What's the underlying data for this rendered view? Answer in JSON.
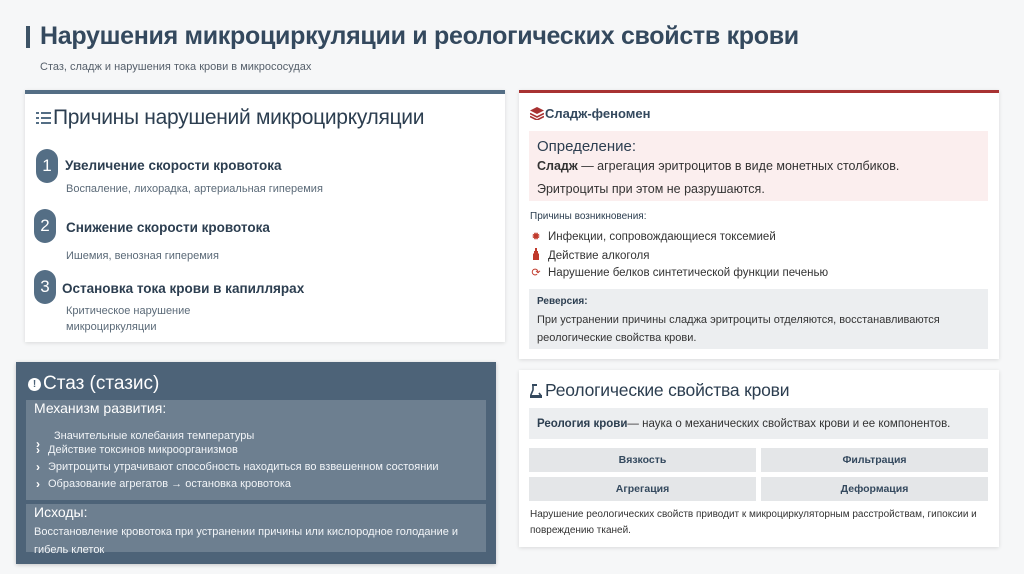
{
  "header": {
    "title": "Нарушения микроциркуляции и реологических свойств крови",
    "subtitle": "Стаз, сладж и нарушения тока крови в микрососудах"
  },
  "causes": {
    "title": "Причины нарушений микроциркуляции",
    "icon": "list-icon",
    "items": [
      {
        "num": "1",
        "title": "Увеличение скорости кровотока",
        "desc": "Воспаление, лихорадка, артериальная гиперемия"
      },
      {
        "num": "2",
        "title": "Снижение скорости кровотока",
        "desc": "Ишемия, венозная гиперемия"
      },
      {
        "num": "3",
        "title": "Остановка тока крови в капиллярах",
        "desc_line1": "Критическое нарушение",
        "desc_line2": "микроциркуляции"
      }
    ]
  },
  "stasis": {
    "title": "Стаз (стазис)",
    "icon": "exclamation-circle-icon",
    "mechanism_head": "Механизм развития:",
    "mechanism": [
      "Значительные колебания температуры",
      "Действие токсинов микроорганизмов",
      "Эритроциты утрачивают способность находиться во взвешенном состоянии",
      "Образование агрегатов → остановка кровотока"
    ],
    "outcome_head": "Исходы:",
    "outcome_text": "Восстановление кровотока при устранении причины или кислородное голодание и гибель клеток"
  },
  "sludge": {
    "title": "Сладж-феномен",
    "icon": "layers-icon",
    "definition_head": "Определение:",
    "definition_term": "Сладж",
    "definition_rest": " — агрегация эритроцитов в виде монетных столбиков.",
    "definition_line2": "Эритроциты при этом не разрушаются.",
    "reasons_head": "Причины возникновения:",
    "reasons": [
      {
        "icon": "virus-icon",
        "text": "Инфекции, сопровождающиеся токсемией"
      },
      {
        "icon": "bottle-icon",
        "text": "Действие алкоголя"
      },
      {
        "icon": "refresh-icon",
        "text": "Нарушение белков синтетической функции печенью"
      }
    ],
    "reversion_head": "Реверсия:",
    "reversion_text": "При устранении причины сладжа эритроциты отделяются, восстанавливаются реологические свойства крови."
  },
  "rheology": {
    "title": "Реологические свойства крови",
    "icon": "flask-icon",
    "def_term": "Реология крови",
    "def_rest": " — наука о механических свойствах крови и ее компонентов.",
    "properties": [
      "Вязкость",
      "Фильтрация",
      "Агрегация",
      "Деформация"
    ],
    "note": "Нарушение реологических свойств приводит к микроциркуляторным расстройствам, гипоксии и повреждению тканей."
  },
  "colors": {
    "accent": "#546e85",
    "dark_panel": "#4d6378",
    "sludge_accent": "#a83232",
    "definition_bg": "#fbeeee"
  }
}
